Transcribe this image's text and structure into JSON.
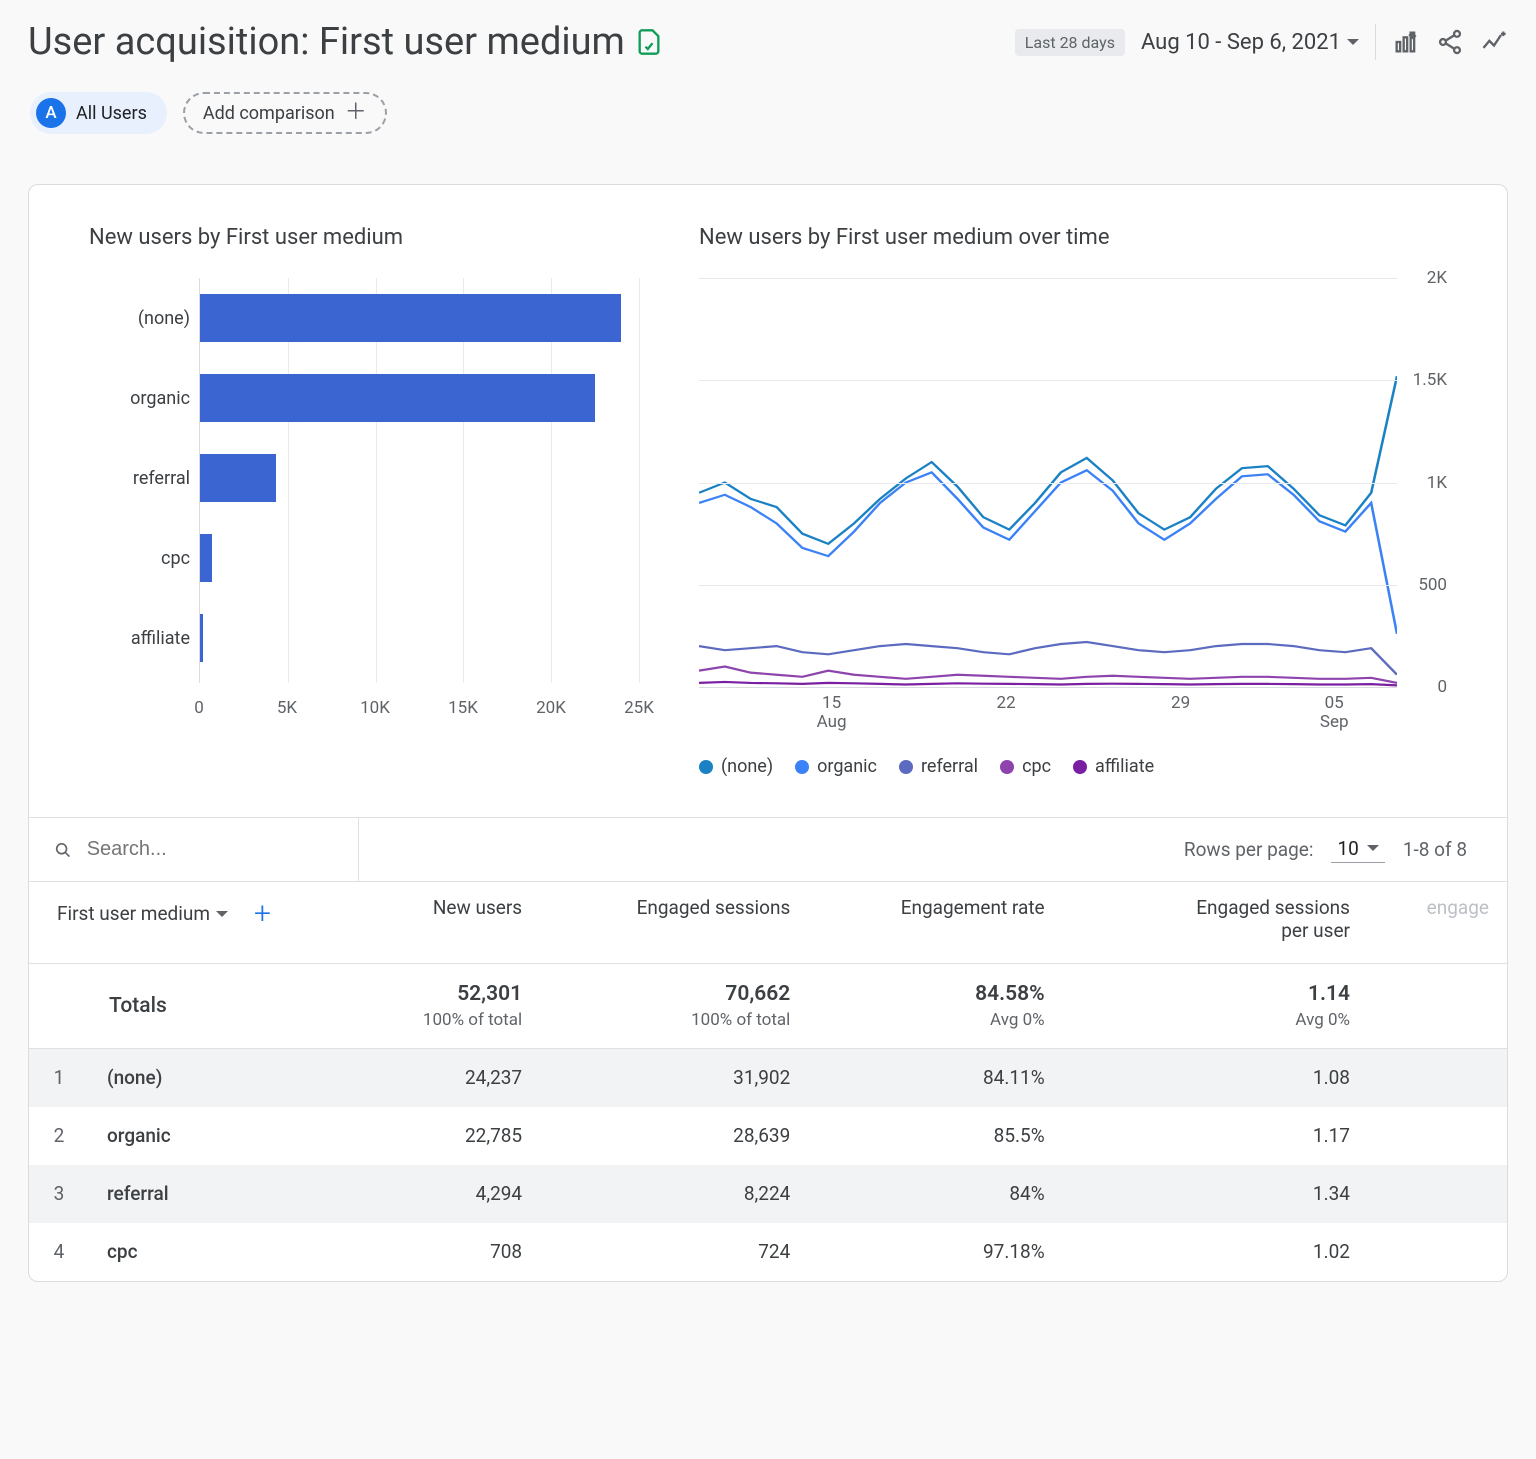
{
  "header": {
    "title": "User acquisition: First user medium",
    "date_badge": "Last 28 days",
    "date_range": "Aug 10 - Sep 6, 2021"
  },
  "chips": {
    "all_users": "All Users",
    "add_comparison": "Add comparison"
  },
  "bar_chart": {
    "x_ticks": [
      "0",
      "5K",
      "10K",
      "15K",
      "20K",
      "25K"
    ]
  },
  "line_chart": {
    "y_ticks": [
      "0",
      "500",
      "1K",
      "1.5K",
      "2K"
    ],
    "x_ticks": [
      {
        "top": "15",
        "bottom": "Aug"
      },
      {
        "top": "22",
        "bottom": ""
      },
      {
        "top": "29",
        "bottom": ""
      },
      {
        "top": "05",
        "bottom": "Sep"
      }
    ]
  },
  "legend": [
    "(none)",
    "organic",
    "referral",
    "cpc",
    "affiliate"
  ],
  "colors": {
    "none": "#1a82c4",
    "organic": "#3b82f6",
    "referral": "#5c6bc0",
    "cpc": "#8e44ad",
    "affiliate": "#7b1fa2"
  },
  "table": {
    "search_placeholder": "Search...",
    "rows_per_label": "Rows per page:",
    "rows_per_value": "10",
    "pagination": "1-8 of 8",
    "dimension": "First user medium",
    "columns": [
      "New users",
      "Engaged sessions",
      "Engagement rate",
      "Engaged sessions per user"
    ],
    "col_extra": "engage",
    "totals_label": "Totals",
    "totals": {
      "new_users": {
        "v": "52,301",
        "s": "100% of total"
      },
      "engaged_sessions": {
        "v": "70,662",
        "s": "100% of total"
      },
      "engagement_rate": {
        "v": "84.58%",
        "s": "Avg 0%"
      },
      "eng_per_user": {
        "v": "1.14",
        "s": "Avg 0%"
      }
    },
    "rows": [
      {
        "idx": "1",
        "name": "(none)",
        "new_users": "24,237",
        "engaged_sessions": "31,902",
        "engagement_rate": "84.11%",
        "eng_per_user": "1.08"
      },
      {
        "idx": "2",
        "name": "organic",
        "new_users": "22,785",
        "engaged_sessions": "28,639",
        "engagement_rate": "85.5%",
        "eng_per_user": "1.17"
      },
      {
        "idx": "3",
        "name": "referral",
        "new_users": "4,294",
        "engaged_sessions": "8,224",
        "engagement_rate": "84%",
        "eng_per_user": "1.34"
      },
      {
        "idx": "4",
        "name": "cpc",
        "new_users": "708",
        "engaged_sessions": "724",
        "engagement_rate": "97.18%",
        "eng_per_user": "1.02"
      }
    ]
  },
  "chart_data": [
    {
      "type": "bar",
      "title": "New users by First user medium",
      "orientation": "horizontal",
      "categories": [
        "(none)",
        "organic",
        "referral",
        "cpc",
        "affiliate"
      ],
      "values": [
        24000,
        22500,
        4300,
        700,
        150
      ],
      "xlabel": "",
      "ylabel": "",
      "xlim": [
        0,
        25000
      ]
    },
    {
      "type": "line",
      "title": "New users by First user medium over time",
      "x": [
        "Aug 10",
        "Aug 11",
        "Aug 12",
        "Aug 13",
        "Aug 14",
        "Aug 15",
        "Aug 16",
        "Aug 17",
        "Aug 18",
        "Aug 19",
        "Aug 20",
        "Aug 21",
        "Aug 22",
        "Aug 23",
        "Aug 24",
        "Aug 25",
        "Aug 26",
        "Aug 27",
        "Aug 28",
        "Aug 29",
        "Aug 30",
        "Aug 31",
        "Sep 01",
        "Sep 02",
        "Sep 03",
        "Sep 04",
        "Sep 05",
        "Sep 06"
      ],
      "series": [
        {
          "name": "(none)",
          "color": "#1a82c4",
          "values": [
            950,
            1000,
            920,
            880,
            750,
            700,
            800,
            920,
            1020,
            1100,
            980,
            830,
            770,
            900,
            1050,
            1120,
            1010,
            850,
            770,
            830,
            970,
            1070,
            1080,
            970,
            840,
            790,
            950,
            1520
          ]
        },
        {
          "name": "organic",
          "color": "#3b82f6",
          "values": [
            900,
            940,
            880,
            800,
            680,
            640,
            760,
            900,
            1000,
            1050,
            920,
            780,
            720,
            860,
            1000,
            1060,
            960,
            800,
            720,
            800,
            920,
            1030,
            1040,
            940,
            810,
            760,
            900,
            260
          ]
        },
        {
          "name": "referral",
          "color": "#5c6bc0",
          "values": [
            200,
            180,
            190,
            200,
            170,
            160,
            180,
            200,
            210,
            200,
            190,
            170,
            160,
            190,
            210,
            220,
            200,
            180,
            170,
            180,
            200,
            210,
            210,
            200,
            180,
            170,
            190,
            60
          ]
        },
        {
          "name": "cpc",
          "color": "#8e44ad",
          "values": [
            80,
            100,
            70,
            60,
            50,
            80,
            60,
            50,
            40,
            50,
            60,
            55,
            50,
            45,
            40,
            50,
            55,
            50,
            45,
            40,
            45,
            50,
            50,
            45,
            40,
            40,
            45,
            20
          ]
        },
        {
          "name": "affiliate",
          "color": "#7b1fa2",
          "values": [
            20,
            25,
            20,
            18,
            15,
            20,
            18,
            15,
            12,
            15,
            18,
            16,
            15,
            14,
            12,
            15,
            16,
            15,
            14,
            12,
            14,
            15,
            15,
            14,
            12,
            12,
            14,
            8
          ]
        }
      ],
      "ylim": [
        0,
        2000
      ],
      "legend_position": "bottom"
    }
  ]
}
